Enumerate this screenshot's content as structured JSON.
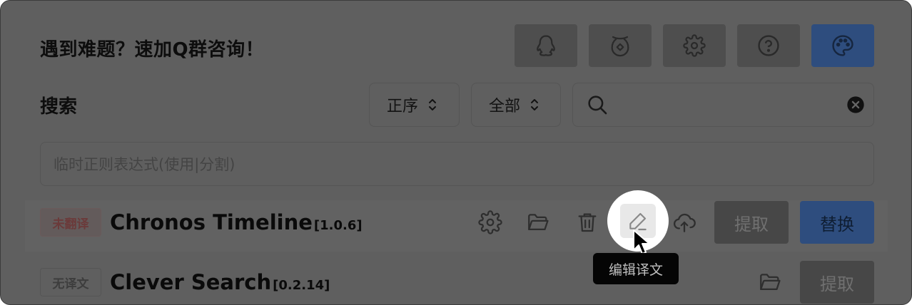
{
  "header": {
    "title": "遇到难题？速加Q群咨询！",
    "buttons": [
      {
        "name": "qq-button",
        "icon": "qq-penguin-icon"
      },
      {
        "name": "donate-button",
        "icon": "coin-purse-icon"
      },
      {
        "name": "settings-button",
        "icon": "gear-icon"
      },
      {
        "name": "help-button",
        "icon": "question-circle-icon"
      },
      {
        "name": "theme-button",
        "icon": "palette-icon"
      }
    ]
  },
  "search": {
    "label": "搜索",
    "order_select": "正序",
    "filter_select": "全部",
    "query": "",
    "regex_placeholder": "临时正则表达式(使用|分割)"
  },
  "plugins": [
    {
      "status": "未翻译",
      "name": "Chronos Timeline",
      "version": "[1.0.6]",
      "actions": [
        "settings-icon",
        "folder-icon",
        "trash-icon",
        "edit-icon",
        "upload-cloud-icon"
      ],
      "extract_label": "提取",
      "replace_label": "替换"
    },
    {
      "status": "无译文",
      "name": "Clever Search",
      "version": "[0.2.14]",
      "actions": [
        "folder-icon"
      ],
      "extract_label": "提取"
    }
  ],
  "tooltip": "编辑译文",
  "colors": {
    "accent": "#2e4d7e",
    "overlay": "#5f5f5f",
    "untranslated_tag": "#6b3a3a"
  }
}
